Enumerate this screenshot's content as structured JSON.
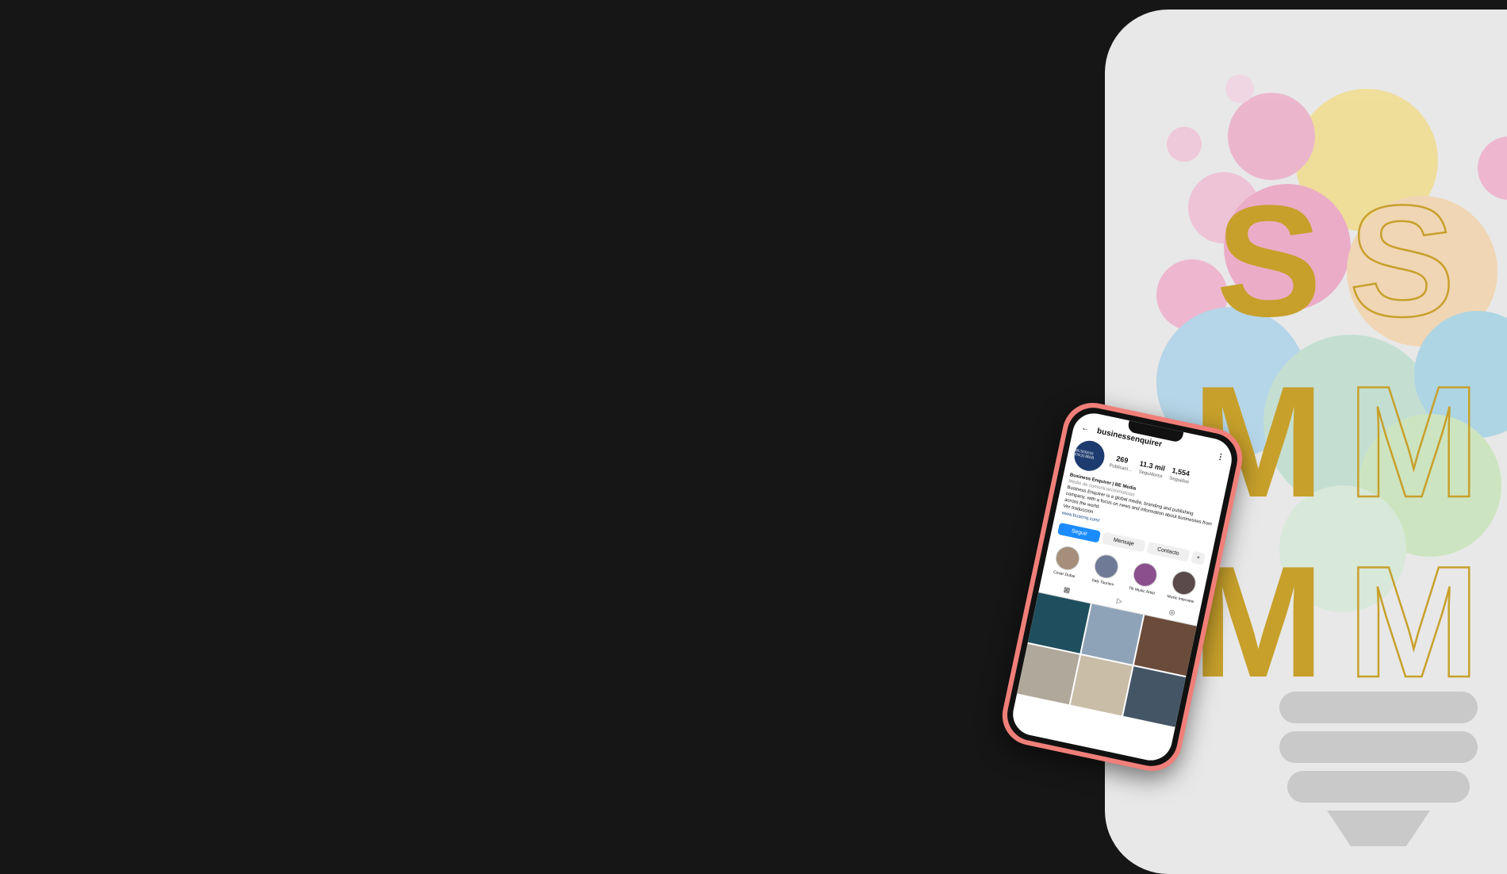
{
  "hero": {
    "letters": [
      {
        "solid": "S",
        "outline": "S"
      },
      {
        "solid": "M",
        "outline": "M"
      },
      {
        "solid": "M",
        "outline": "M"
      }
    ],
    "accent_color": "#c7a02b"
  },
  "phone": {
    "username": "businessenquirer",
    "back_icon": "back-arrow-icon",
    "menu_icon": "more-icon",
    "avatar_text": "BUSINESS ENQUIRER",
    "stats": [
      {
        "value": "269",
        "label": "Publicaci..."
      },
      {
        "value": "11.3 mil",
        "label": "Seguidores"
      },
      {
        "value": "1,554",
        "label": "Seguidos"
      }
    ],
    "bio": {
      "name": "Business Enquirer | BE Media",
      "category": "Medio de comunicación/noticias",
      "text": "Business Enquirer is a global media, branding and publishing company, with a focus on news and information about businesses from across the world.",
      "translate": "Ver traducción",
      "link": "www.busenq.com/"
    },
    "buttons": [
      "Seguir",
      "Mensaje",
      "Contacto",
      "+"
    ],
    "highlights": [
      "Cover Dubai",
      "Italy Tourism",
      "Tik Music Artist",
      "Music Interview"
    ]
  }
}
